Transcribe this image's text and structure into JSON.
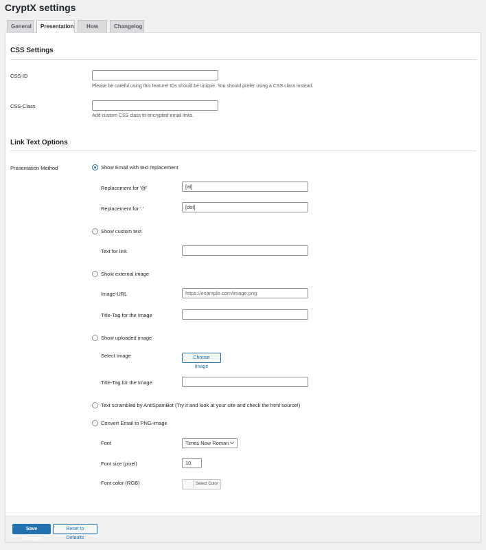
{
  "page_title": "CryptX settings",
  "tabs": [
    {
      "label": "General"
    },
    {
      "label": "Presentation"
    },
    {
      "label": "How to..."
    },
    {
      "label": "Changelog"
    }
  ],
  "css_settings": {
    "title": "CSS Settings",
    "css_id": {
      "label": "CSS-ID",
      "value": "",
      "description": "Please be careful using this feature! IDs should be unique. You should prefer using a CSS class instead."
    },
    "css_class": {
      "label": "CSS-Class",
      "value": "",
      "description": "Add custom CSS class to encrypted email links."
    }
  },
  "link_text": {
    "title": "Link Text Options",
    "method_label": "Presentation Method",
    "opt_replacement": {
      "label": "Show Email with text replacement",
      "checked": true,
      "at_label": "Replacement for '@'",
      "at_value": "[at]",
      "dot_label": "Replacement for '.'",
      "dot_value": "[dot]"
    },
    "opt_custom_text": {
      "label": "Show custom text",
      "checked": false,
      "text_label": "Text for link",
      "text_value": ""
    },
    "opt_external_image": {
      "label": "Show external image",
      "checked": false,
      "url_label": "Image-URL",
      "url_placeholder": "https://example.com/image.png",
      "title_label": "Title-Tag for the Image",
      "title_value": ""
    },
    "opt_uploaded_image": {
      "label": "Show uploaded image",
      "checked": false,
      "select_label": "Select Image",
      "choose_button": "Choose Image",
      "title_label": "Title-Tag for the Image",
      "title_value": ""
    },
    "opt_scrambled": {
      "label": "Text scrambled by AntiSpamBot (Try it and look at your site and check the html source!)",
      "checked": false
    },
    "opt_png": {
      "label": "Convert Email to PNG-image",
      "checked": false,
      "font_label": "Font",
      "font_value": "Times New Roman",
      "font_size_label": "Font size (pixel)",
      "font_size_value": "10",
      "font_color_label": "Font color (RGB)",
      "font_color_button": "Select Color"
    }
  },
  "footer": {
    "save_label": "Save Changes",
    "reset_label": "Reset to Defaults"
  },
  "colors": {
    "accent": "#2271b1",
    "background": "#f0f0f1",
    "panel": "#ffffff"
  }
}
